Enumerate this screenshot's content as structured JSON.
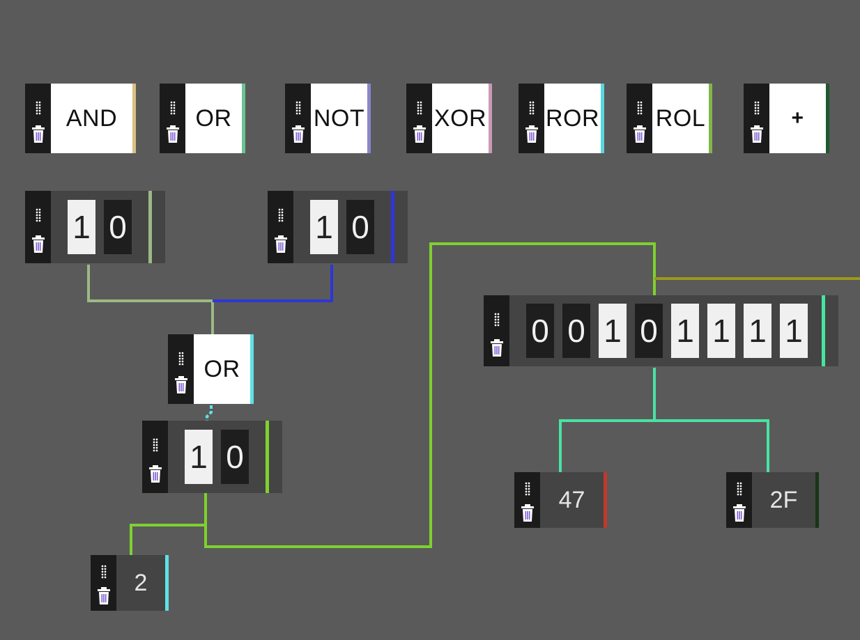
{
  "palette_gates": [
    {
      "label": "AND",
      "accent": "#d8c081"
    },
    {
      "label": "OR",
      "accent": "#6cc393"
    },
    {
      "label": "NOT",
      "accent": "#8a87c9"
    },
    {
      "label": "XOR",
      "accent": "#c99ab5"
    },
    {
      "label": "ROR",
      "accent": "#5ad6df"
    },
    {
      "label": "ROL",
      "accent": "#83b54a"
    },
    {
      "label": "+",
      "accent": "#1f5a2e"
    }
  ],
  "input_a": {
    "bits": [
      "1",
      "0"
    ],
    "accent": "#9cb985"
  },
  "input_b": {
    "bits": [
      "1",
      "0"
    ],
    "accent": "#2e36d6"
  },
  "or_gate": {
    "label": "OR",
    "accent": "#5fe1e6"
  },
  "or_result": {
    "bits": [
      "1",
      "0"
    ],
    "accent": "#7fd12f"
  },
  "decimal_output": {
    "value": "2",
    "accent": "#5fe1e6"
  },
  "byte_register": {
    "bits": [
      "0",
      "0",
      "1",
      "0",
      "1",
      "1",
      "1",
      "1"
    ],
    "accent": "#48e3a3"
  },
  "char_output": {
    "value": "47",
    "accent": "#c0392b"
  },
  "hex_output": {
    "value": "2F",
    "accent": "#183618"
  },
  "wire_colors": {
    "input_a": "#9cb985",
    "input_b": "#2e36d6",
    "or_out": "#5fe1e6",
    "result": "#7fd12f",
    "byte": "#48e3a3",
    "offscreen": "#9a9a18"
  }
}
